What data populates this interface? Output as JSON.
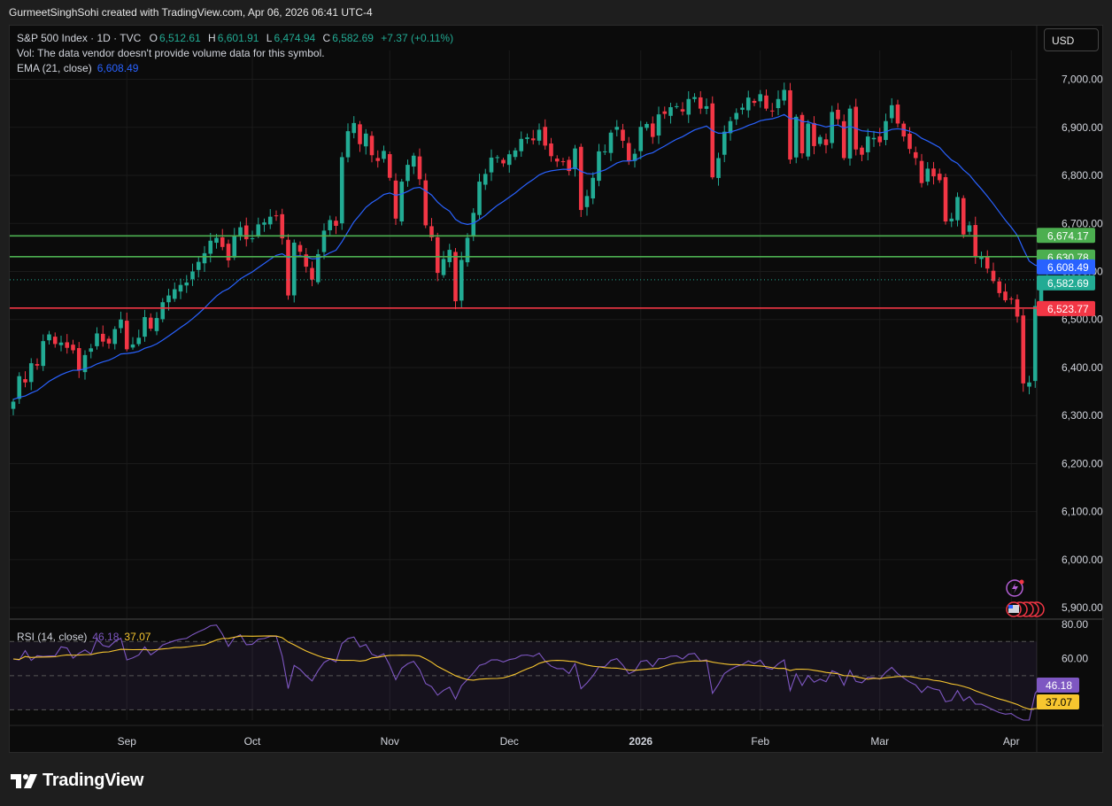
{
  "attribution": "GurmeetSinghSohi created with TradingView.com, Apr 06, 2026 06:41 UTC-4",
  "legend": {
    "symbol": "S&P 500 Index · 1D · TVC",
    "o_label": "O",
    "o_value": "6,512.61",
    "h_label": "H",
    "h_value": "6,601.91",
    "l_label": "L",
    "l_value": "6,474.94",
    "c_label": "C",
    "c_value": "6,582.69",
    "change": "+7.37 (+0.11%)",
    "vol_note": "Vol: The data vendor doesn't provide volume data for this symbol.",
    "ema_label": "EMA (21, close)",
    "ema_value": "6,608.49",
    "rsi_label": "RSI (14, close)",
    "rsi_value": "46.18",
    "rsi_ma_value": "37.07"
  },
  "currency_button": "USD",
  "footer_brand": "TradingView",
  "colors": {
    "up": "#22ab94",
    "down": "#f23645",
    "ema": "#2962ff",
    "rsi": "#7e57c2",
    "rsi_ma": "#f7c62f",
    "support_line": "#4caf50",
    "resistance_line": "#f23645",
    "background": "#0b0b0b"
  },
  "icons": [
    "lightning-icon",
    "us-flag-events-icon",
    "tradingview-logo-icon"
  ],
  "chart_data": {
    "type": "candlestick",
    "ylim": [
      5880,
      7060
    ],
    "y_ticks": [
      5900,
      6000,
      6100,
      6200,
      6300,
      6400,
      6500,
      6600,
      6700,
      6800,
      6900,
      7000
    ],
    "y_tick_labels": [
      "5,900.00",
      "6,000.00",
      "6,100.00",
      "6,200.00",
      "6,300.00",
      "6,400.00",
      "6,500.00",
      "6,600.00",
      "6,700.00",
      "6,800.00",
      "6,900.00",
      "7,000.00"
    ],
    "x_labels": [
      {
        "label": "Sep",
        "index": 19
      },
      {
        "label": "Oct",
        "index": 40
      },
      {
        "label": "Nov",
        "index": 63
      },
      {
        "label": "Dec",
        "index": 83
      },
      {
        "label": "2026",
        "index": 105,
        "bold": true
      },
      {
        "label": "Feb",
        "index": 125
      },
      {
        "label": "Mar",
        "index": 145
      },
      {
        "label": "Apr",
        "index": 167
      }
    ],
    "closes": [
      6329,
      6382,
      6369,
      6409,
      6404,
      6455,
      6469,
      6449,
      6452,
      6441,
      6436,
      6395,
      6426,
      6440,
      6471,
      6454,
      6450,
      6480,
      6500,
      6438,
      6448,
      6462,
      6505,
      6481,
      6503,
      6536,
      6550,
      6563,
      6572,
      6577,
      6600,
      6620,
      6638,
      6664,
      6670,
      6651,
      6623,
      6673,
      6692,
      6667,
      6669,
      6698,
      6702,
      6714,
      6715,
      6669,
      6550,
      6660,
      6641,
      6610,
      6583,
      6636,
      6685,
      6707,
      6695,
      6838,
      6892,
      6909,
      6865,
      6887,
      6842,
      6830,
      6851,
      6795,
      6710,
      6787,
      6822,
      6841,
      6792,
      6696,
      6671,
      6597,
      6626,
      6645,
      6538,
      6624,
      6670,
      6722,
      6787,
      6803,
      6837,
      6838,
      6825,
      6844,
      6852,
      6876,
      6879,
      6873,
      6895,
      6862,
      6840,
      6829,
      6829,
      6809,
      6856,
      6728,
      6757,
      6795,
      6850,
      6850,
      6889,
      6901,
      6872,
      6830,
      6845,
      6901,
      6907,
      6880,
      6927,
      6928,
      6942,
      6944,
      6933,
      6959,
      6963,
      6939,
      6944,
      6796,
      6836,
      6891,
      6913,
      6930,
      6941,
      6962,
      6951,
      6969,
      6939,
      6934,
      6959,
      6978,
      6833,
      6922,
      6846,
      6908,
      6861,
      6880,
      6863,
      6932,
      6917,
      6836,
      6939,
      6854,
      6843,
      6881,
      6878,
      6869,
      6913,
      6946,
      6908,
      6881,
      6855,
      6836,
      6784,
      6814,
      6798,
      6790,
      6704,
      6710,
      6755,
      6677,
      6696,
      6632,
      6631,
      6606,
      6580,
      6555,
      6540,
      6542,
      6506,
      6367,
      6369,
      6528,
      6575,
      6583
    ],
    "ema_last": 6608.49,
    "price_levels": [
      {
        "value": 6674.17,
        "label": "6,674.17",
        "kind": "support_line"
      },
      {
        "value": 6630.78,
        "label": "6,630.78",
        "kind": "support_line"
      },
      {
        "value": 6608.49,
        "label": "6,608.49",
        "kind": "ema"
      },
      {
        "value": 6582.69,
        "label": "6,582.69",
        "kind": "last_price"
      },
      {
        "value": 6523.77,
        "label": "6,523.77",
        "kind": "resistance_line"
      }
    ],
    "rsi": {
      "ylim": [
        24,
        81
      ],
      "y_ticks": [
        {
          "value": 80,
          "label": "80.00"
        },
        {
          "value": 60,
          "label": "60.00"
        }
      ],
      "band": [
        30,
        70
      ],
      "last": 46.18,
      "ma_last": 37.07
    }
  }
}
